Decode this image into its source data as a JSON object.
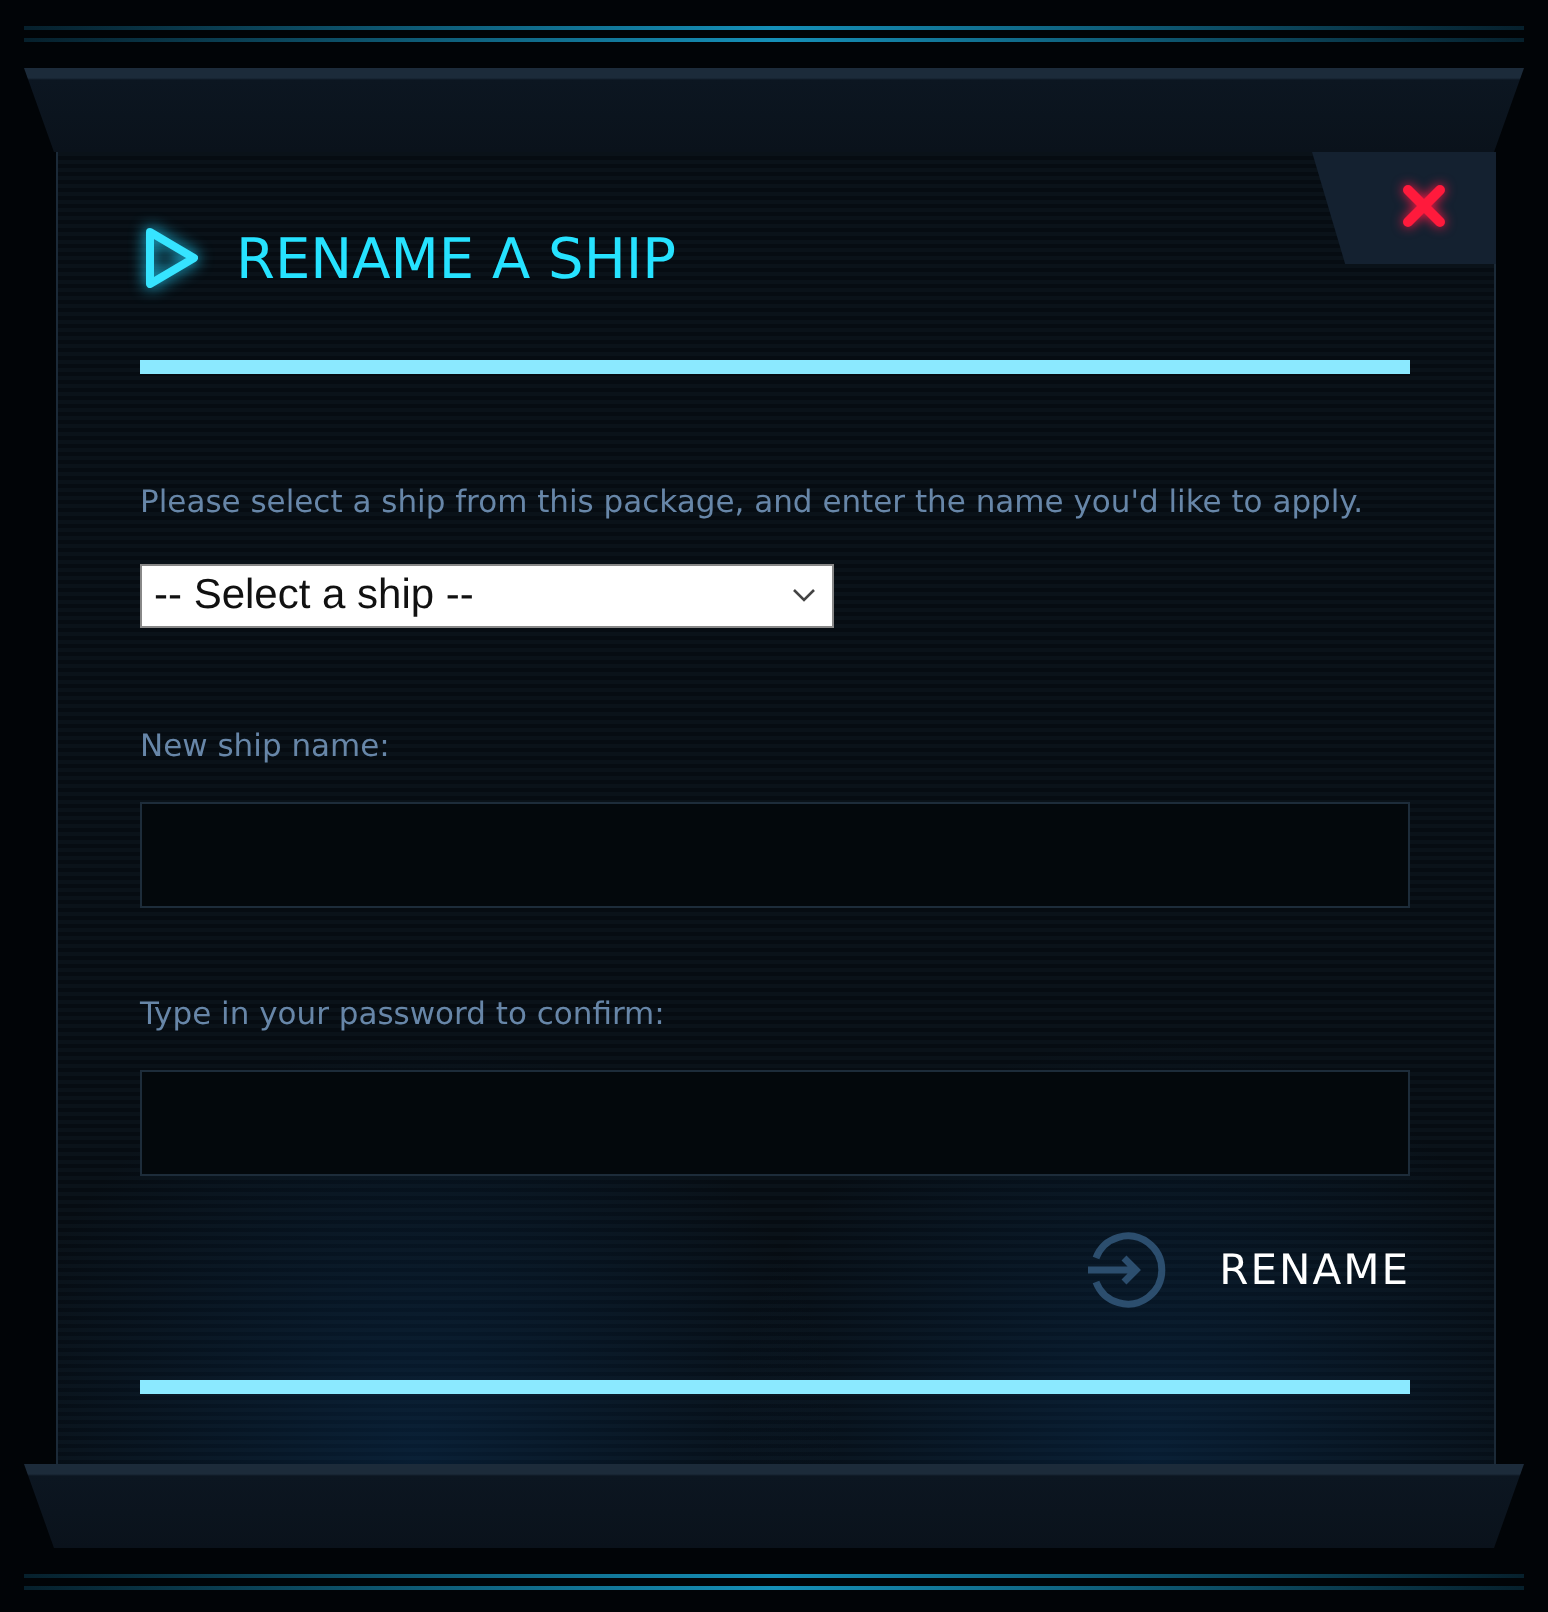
{
  "dialog": {
    "title": "RENAME A SHIP",
    "description": "Please select a ship from this package, and enter the name you'd like to apply.",
    "ship_select": {
      "value": "-- Select a ship --"
    },
    "fields": [
      {
        "label": "New ship name:"
      },
      {
        "label": "Type in your password to confirm:"
      }
    ],
    "submit_button": {
      "label": "RENAME"
    }
  }
}
